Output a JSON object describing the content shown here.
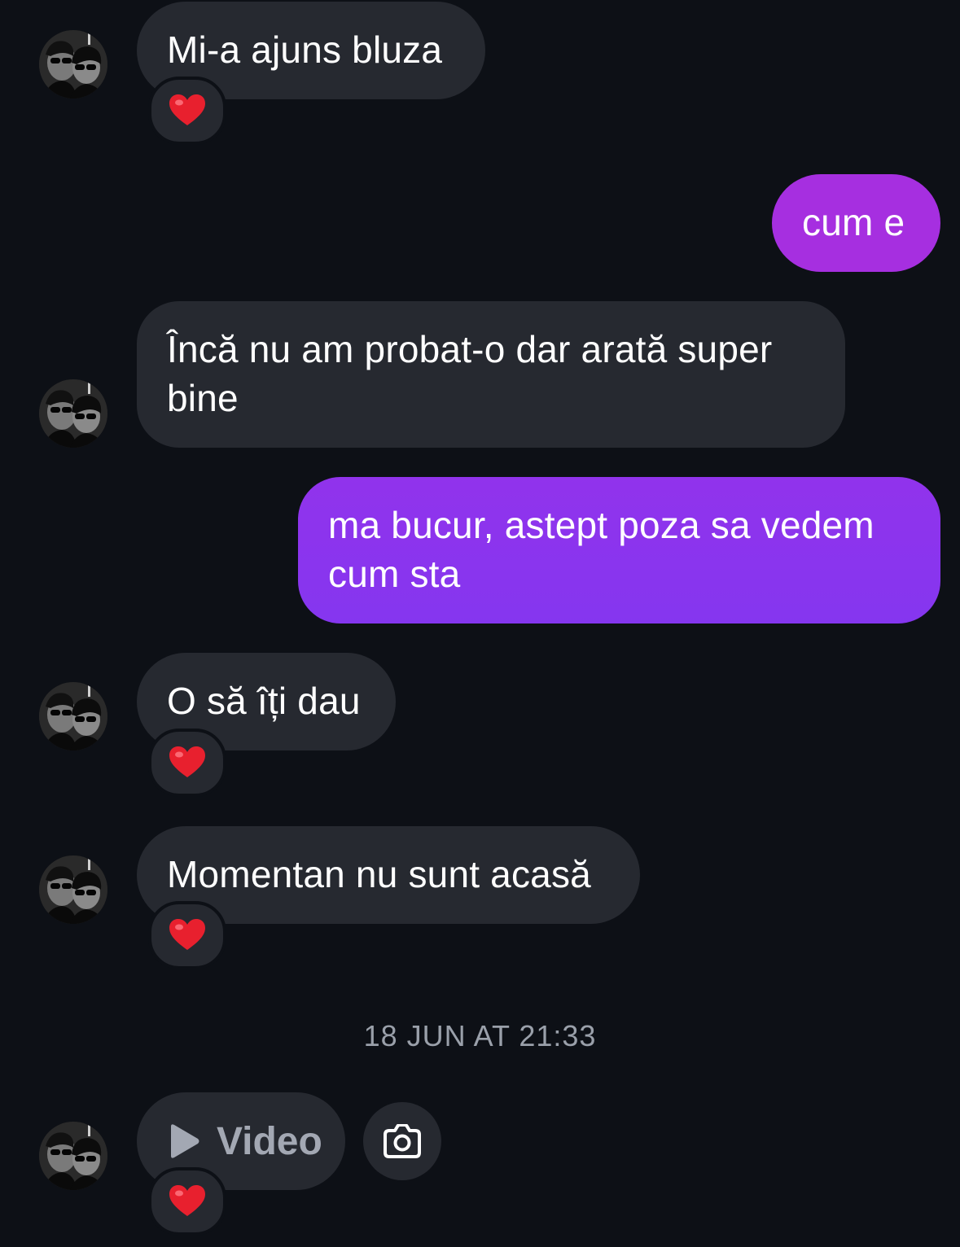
{
  "colors": {
    "background": "#0d1016",
    "incoming_bubble": "#262930",
    "outgoing_gradient": [
      "#a032e0",
      "#7f36ee"
    ],
    "reaction_heart": "#e8202e",
    "timestamp": "#9aa0aa"
  },
  "messages": [
    {
      "direction": "incoming",
      "text": "Mi-a ajuns bluza",
      "reaction": "heart-icon"
    },
    {
      "direction": "outgoing",
      "text": "cum e"
    },
    {
      "direction": "incoming",
      "text": "Încă nu am probat-o dar arată super bine"
    },
    {
      "direction": "outgoing",
      "text": "ma bucur, astept poza sa vedem cum sta"
    },
    {
      "direction": "incoming",
      "text": "O să îți dau",
      "reaction": "heart-icon"
    },
    {
      "direction": "incoming",
      "text": "Momentan nu sunt acasă",
      "reaction": "heart-icon"
    }
  ],
  "timestamp": "18 JUN AT 21:33",
  "video_message": {
    "label": "Video",
    "icon": "play-icon",
    "reaction": "heart-icon",
    "action_icon": "camera-icon"
  }
}
